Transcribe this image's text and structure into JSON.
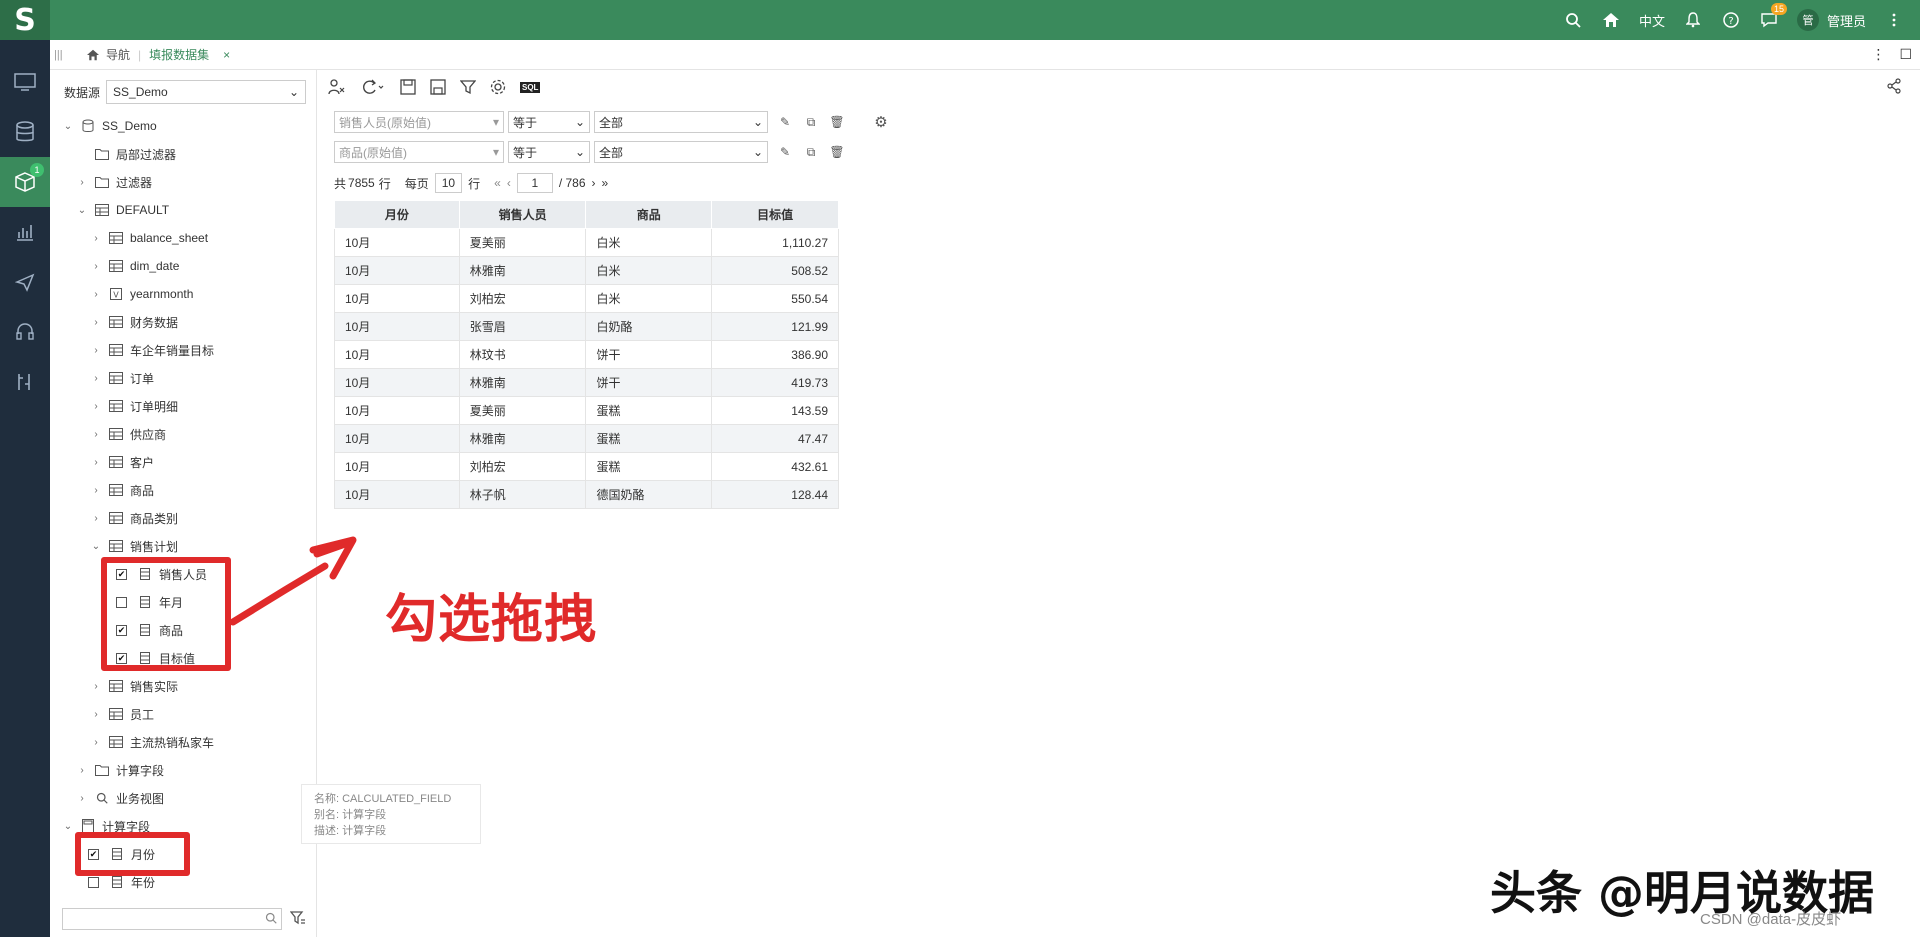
{
  "header": {
    "logo": "S",
    "language": "中文",
    "chat_badge": "15",
    "avatar": "管",
    "username": "管理员"
  },
  "left_nav": {
    "badge": "1"
  },
  "tabs": {
    "nav_label": "导航",
    "active_label": "填报数据集",
    "close": "×"
  },
  "datasource": {
    "label": "数据源",
    "value": "SS_Demo"
  },
  "tree": {
    "root": "SS_Demo",
    "local_filter": "局部过滤器",
    "filter": "过滤器",
    "default": "DEFAULT",
    "tables": [
      "balance_sheet",
      "dim_date",
      "yearnmonth",
      "财务数据",
      "车企年销量目标",
      "订单",
      "订单明细",
      "供应商",
      "客户",
      "商品",
      "商品类别",
      "销售计划"
    ],
    "plan_fields": [
      {
        "label": "销售人员",
        "checked": "✔"
      },
      {
        "label": "年月",
        "checked": ""
      },
      {
        "label": "商品",
        "checked": "✔"
      },
      {
        "label": "目标值",
        "checked": "✔"
      }
    ],
    "tables_after": [
      "销售实际",
      "员工",
      "主流热销私家车"
    ],
    "calc_folder": "计算字段",
    "biz_view": "业务视图",
    "calc_root": "计算字段",
    "calc_fields": [
      {
        "label": "月份",
        "checked": "✔"
      },
      {
        "label": "年份",
        "checked": ""
      }
    ]
  },
  "tooltip": {
    "line1": "名称:  CALCULATED_FIELD",
    "line2": "别名:  计算字段",
    "line3": "描述:  计算字段"
  },
  "toolbar": {
    "sql_label": "SQL"
  },
  "filters": [
    {
      "field": "销售人员(原始值)",
      "op": "等于",
      "value": "全部"
    },
    {
      "field": "商品(原始值)",
      "op": "等于",
      "value": "全部"
    }
  ],
  "pager": {
    "total_prefix": "共",
    "total": "7855",
    "row_unit": "行",
    "per_page_label": "每页",
    "per_page": "10",
    "per_page_unit": "行",
    "page": "1",
    "page_total": "/ 786"
  },
  "table": {
    "headers": [
      "月份",
      "销售人员",
      "商品",
      "目标值"
    ],
    "rows": [
      [
        "10月",
        "夏美丽",
        "白米",
        "1,110.27"
      ],
      [
        "10月",
        "林雅南",
        "白米",
        "508.52"
      ],
      [
        "10月",
        "刘柏宏",
        "白米",
        "550.54"
      ],
      [
        "10月",
        "张雪眉",
        "白奶酪",
        "121.99"
      ],
      [
        "10月",
        "林玟书",
        "饼干",
        "386.90"
      ],
      [
        "10月",
        "林雅南",
        "饼干",
        "419.73"
      ],
      [
        "10月",
        "夏美丽",
        "蛋糕",
        "143.59"
      ],
      [
        "10月",
        "林雅南",
        "蛋糕",
        "47.47"
      ],
      [
        "10月",
        "刘柏宏",
        "蛋糕",
        "432.61"
      ],
      [
        "10月",
        "林子帆",
        "德国奶酪",
        "128.44"
      ]
    ]
  },
  "annotation": {
    "text": "勾选拖拽",
    "color": "#e02a2a"
  },
  "watermark": {
    "main": "头条 @明月说数据",
    "csdn": "CSDN @data-皮皮虾"
  },
  "colors": {
    "brand": "#3a8a5c",
    "nav_bg": "#1f2d3d"
  }
}
